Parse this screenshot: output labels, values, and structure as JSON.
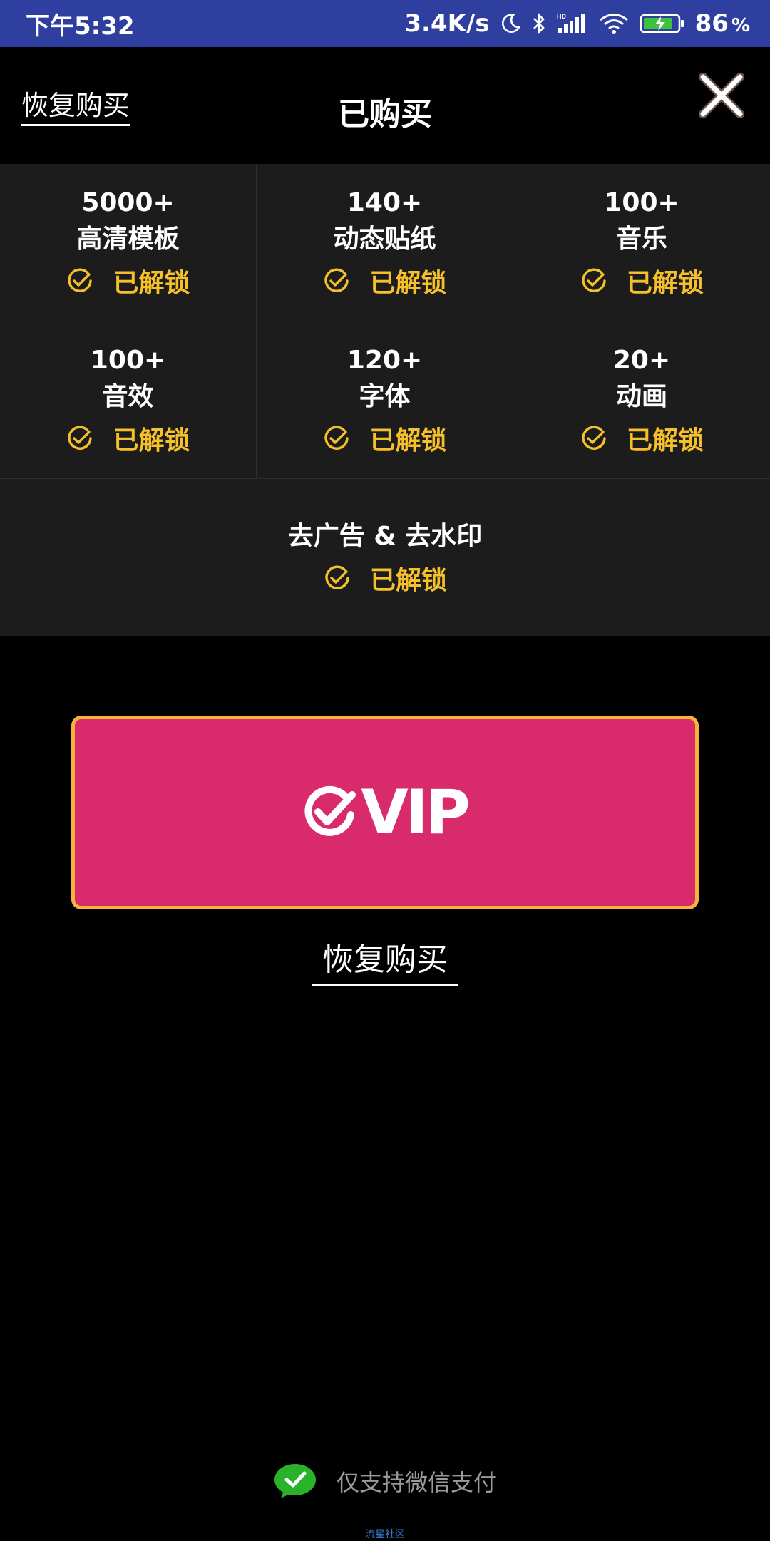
{
  "status_bar": {
    "time": "下午5:32",
    "net_speed": "3.4K/s",
    "battery": "86",
    "percent": "%"
  },
  "header": {
    "restore_label": "恢复购买",
    "title": "已购买"
  },
  "features": [
    {
      "count": "5000+",
      "name": "高清模板",
      "status": "已解锁"
    },
    {
      "count": "140+",
      "name": "动态贴纸",
      "status": "已解锁"
    },
    {
      "count": "100+",
      "name": "音乐",
      "status": "已解锁"
    },
    {
      "count": "100+",
      "name": "音效",
      "status": "已解锁"
    },
    {
      "count": "120+",
      "name": "字体",
      "status": "已解锁"
    },
    {
      "count": "20+",
      "name": "动画",
      "status": "已解锁"
    }
  ],
  "wide_feature": {
    "name": "去广告 & 去水印",
    "status": "已解锁"
  },
  "vip_button": {
    "label": "VIP"
  },
  "restore_button": {
    "label": "恢复购买"
  },
  "footer": {
    "payment_note": "仅支持微信支付",
    "watermark": "流星社区"
  },
  "colors": {
    "accent_yellow": "#f5c02a",
    "vip_pink": "#d92b6b",
    "vip_border": "#f6b43a",
    "status_bar_bg": "#2f3f9f",
    "wechat_green": "#2ab32a"
  },
  "icons": {
    "close": "close-icon",
    "unlock": "check-circle-icon",
    "vip": "vip-check-icon",
    "payment": "wechat-icon"
  }
}
